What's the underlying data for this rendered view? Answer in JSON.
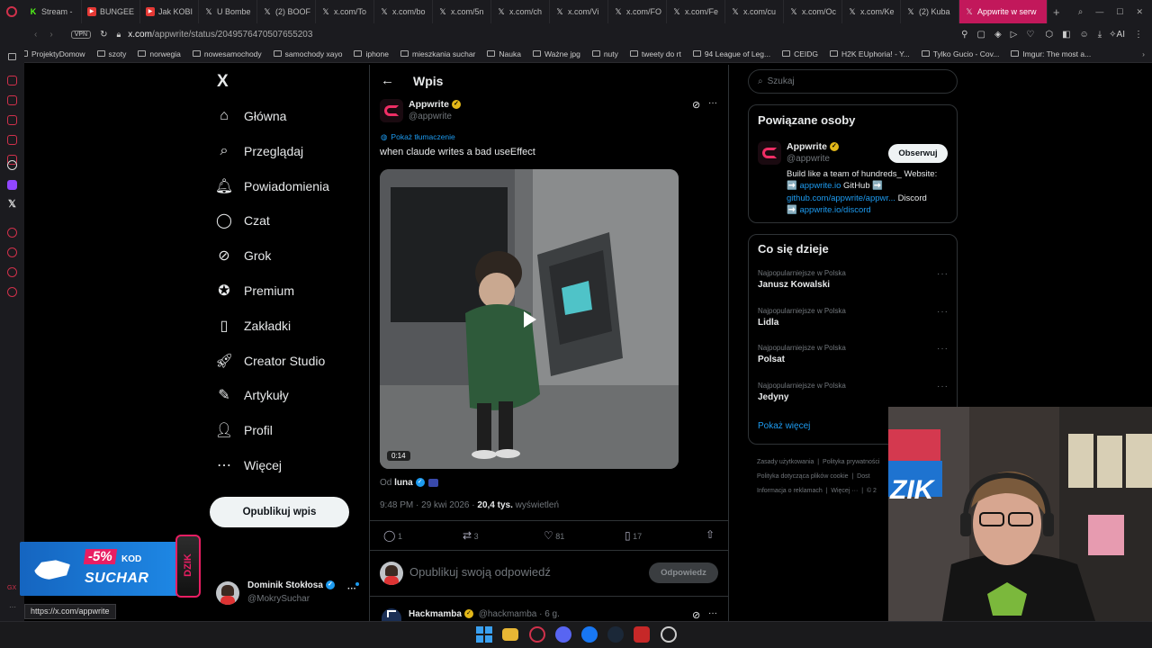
{
  "browser": {
    "tabs": [
      {
        "label": "Stream -",
        "icon": "K"
      },
      {
        "label": "BUNGEE",
        "icon": "yt"
      },
      {
        "label": "Jak KOBI",
        "icon": "yt"
      },
      {
        "label": "U Bombe",
        "icon": "X"
      },
      {
        "label": "(2) BOOF",
        "icon": "X"
      },
      {
        "label": "x.com/To",
        "icon": "X"
      },
      {
        "label": "x.com/bo",
        "icon": "X"
      },
      {
        "label": "x.com/5n",
        "icon": "X"
      },
      {
        "label": "x.com/ch",
        "icon": "X"
      },
      {
        "label": "x.com/Vi",
        "icon": "X"
      },
      {
        "label": "x.com/FO",
        "icon": "X"
      },
      {
        "label": "x.com/Fe",
        "icon": "X"
      },
      {
        "label": "x.com/cu",
        "icon": "X"
      },
      {
        "label": "x.com/Oc",
        "icon": "X"
      },
      {
        "label": "x.com/Ke",
        "icon": "X"
      },
      {
        "label": "(2) Kuba",
        "icon": "X"
      },
      {
        "label": "Appwrite w serw",
        "icon": "X",
        "active": true
      }
    ],
    "vpn_label": "VPN",
    "url_host": "x.com",
    "url_path": "/appwrite/status/2049576470507655203",
    "ai_label": "AI",
    "bookmarks": [
      "ProjektyDomow",
      "szoty",
      "norwegia",
      "nowesamochody",
      "samochody xayo",
      "iphone",
      "mieszkania suchar",
      "Nauka",
      "Ważne jpg",
      "nuty",
      "tweety do rt",
      "94 League of Leg...",
      "CEIDG",
      "H2K EUphoria! - Y...",
      "Tylko Gucio - Cov...",
      "Imgur: The most a..."
    ],
    "status_url": "https://x.com/appwrite"
  },
  "nav": {
    "logo": "X",
    "items": [
      {
        "label": "Główna",
        "icon": "home-icon"
      },
      {
        "label": "Przeglądaj",
        "icon": "search-icon"
      },
      {
        "label": "Powiadomienia",
        "icon": "bell-icon"
      },
      {
        "label": "Czat",
        "icon": "chat-icon"
      },
      {
        "label": "Grok",
        "icon": "grok-icon"
      },
      {
        "label": "Premium",
        "icon": "premium-icon"
      },
      {
        "label": "Zakładki",
        "icon": "bookmark-icon"
      },
      {
        "label": "Creator Studio",
        "icon": "rocket-icon"
      },
      {
        "label": "Artykuły",
        "icon": "article-icon"
      },
      {
        "label": "Profil",
        "icon": "user-icon"
      },
      {
        "label": "Więcej",
        "icon": "more-icon"
      }
    ],
    "post_button": "Opublikuj wpis",
    "account": {
      "name": "Dominik Stokłosa",
      "handle": "@MokrySuchar"
    }
  },
  "promo": {
    "discount": "-5%",
    "kod": "KOD",
    "code": "SUCHAR",
    "brand": "DZIK"
  },
  "post": {
    "header_title": "Wpis",
    "author_name": "Appwrite",
    "author_handle": "@appwrite",
    "translate_label": "Pokaż tłumaczenie",
    "text": "when claude writes a bad useEffect",
    "video_duration": "0:14",
    "from_prefix": "Od",
    "from_user": "luna",
    "time": "9:48 PM · 29 kwi 2026 · ",
    "views_count": "20,4 tys.",
    "views_label": " wyświetleń",
    "replies": "1",
    "reposts": "3",
    "likes": "81",
    "bookmarks": "17",
    "reply_placeholder": "Opublikuj swoją odpowiedź",
    "reply_button": "Odpowiedz",
    "next_name": "Hackmamba",
    "next_handle": "@hackmamba · 6 g."
  },
  "sidebar": {
    "search_placeholder": "Szukaj",
    "related_title": "Powiązane osoby",
    "related": {
      "name": "Appwrite",
      "handle": "@appwrite",
      "follow": "Obserwuj",
      "bio_1": "Build like a team of hundreds_ Website:",
      "bio_2a": "➡️ ",
      "bio_2b": "appwrite.io",
      "bio_2c": " GitHub ➡️",
      "bio_3a": "github.com/appwrite/appwr...",
      "bio_3b": " Discord",
      "bio_4a": "➡️ ",
      "bio_4b": "appwrite.io/discord"
    },
    "trends_title": "Co się dzieje",
    "trends": [
      {
        "category": "Najpopularniejsze w Polska",
        "name": "Janusz Kowalski"
      },
      {
        "category": "Najpopularniejsze w Polska",
        "name": "Lidla"
      },
      {
        "category": "Najpopularniejsze w Polska",
        "name": "Polsat"
      },
      {
        "category": "Najpopularniejsze w Polska",
        "name": "Jedyny"
      }
    ],
    "show_more": "Pokaż więcej",
    "footer_1a": "Zasady użytkowania",
    "footer_1b": "Polityka prywatności",
    "footer_2a": "Polityka dotycząca plików cookie",
    "footer_2b": "Dost",
    "footer_3a": "Informacja o reklamach",
    "footer_3b": "Więcej ···",
    "footer_3c": "© 2"
  },
  "webcam": {
    "sign_text": "ZIK"
  },
  "colors": {
    "brand_pink": "#f02e65",
    "x_blue": "#1d9bf0",
    "tab_active": "#c2185b",
    "verified_gold": "#e2b719"
  }
}
